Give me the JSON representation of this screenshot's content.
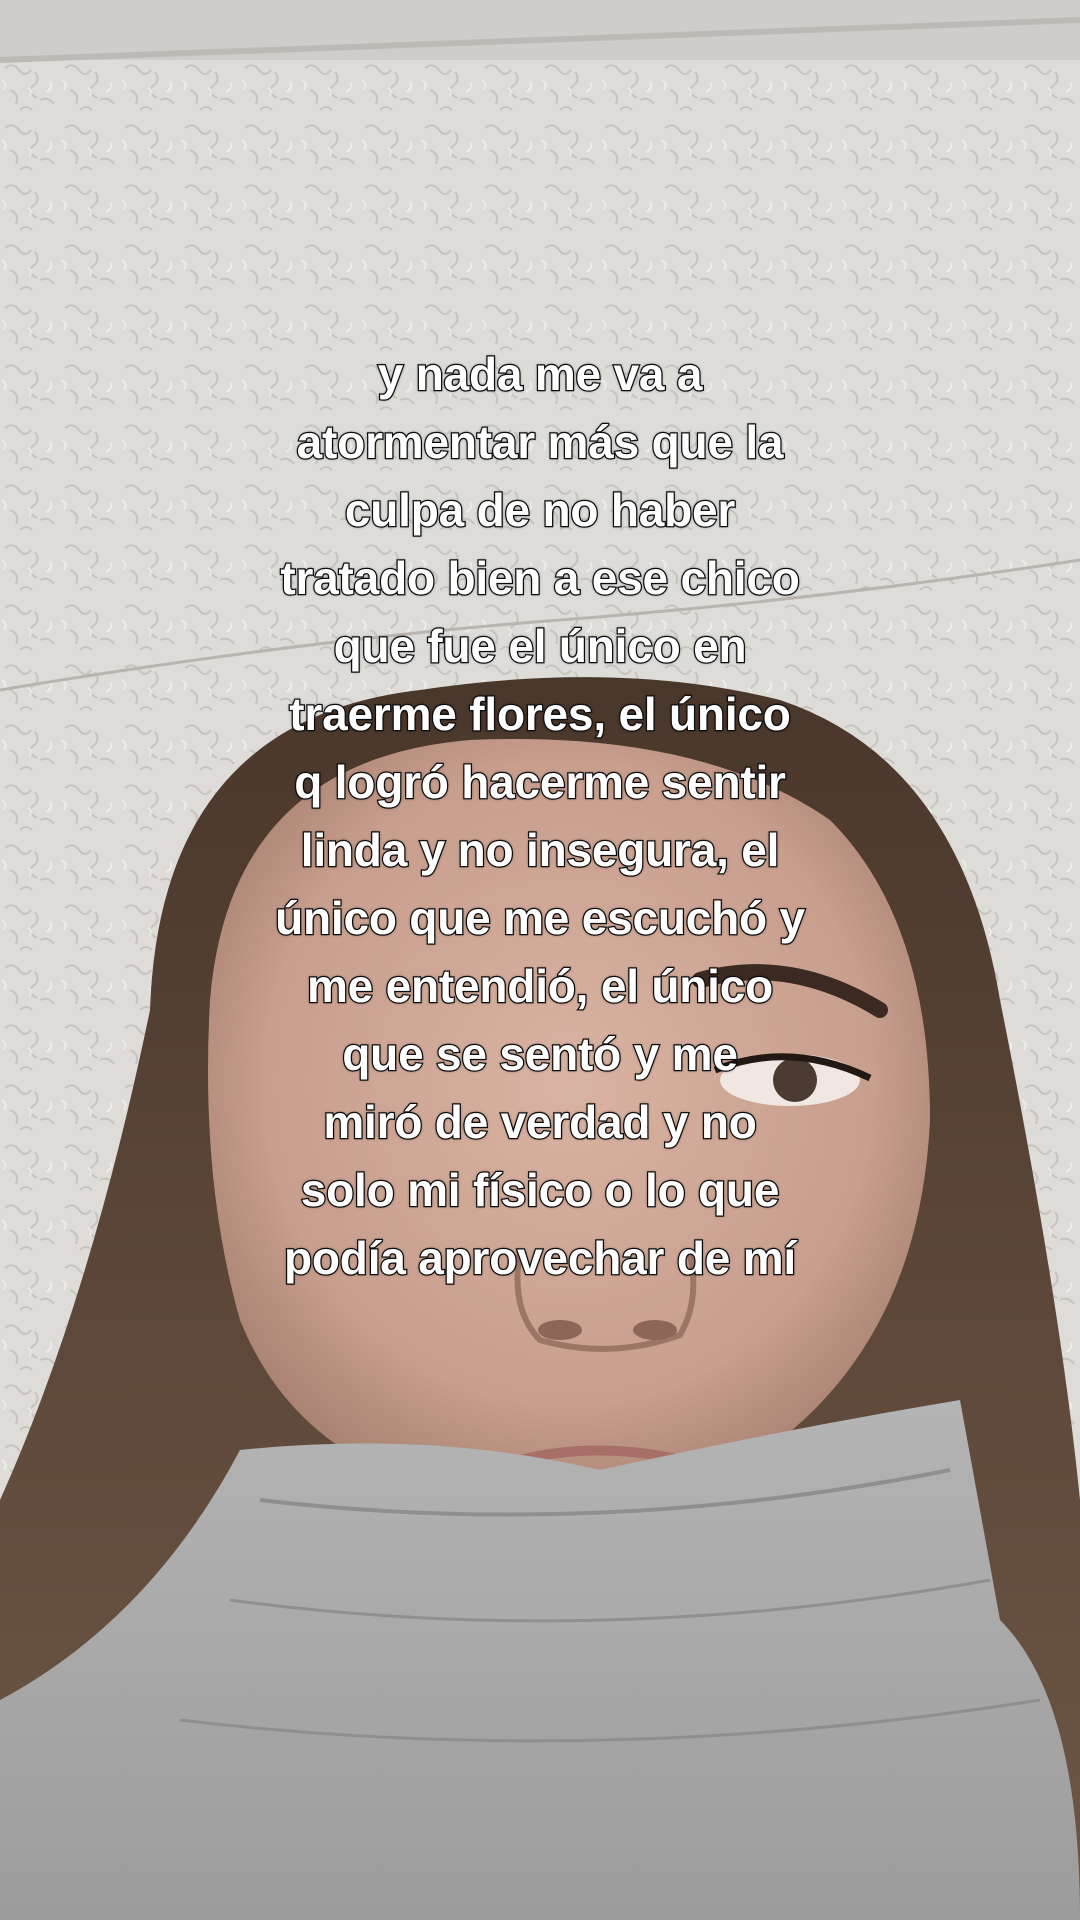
{
  "caption": {
    "lines": [
      "y nada me va a",
      "atormentar más que la",
      "culpa de no haber",
      "tratado bien a ese chico",
      "que fue el único en",
      "traerme flores, el único",
      "q logró hacerme sentir",
      "linda y no insegura, el",
      "único que me escuchó y",
      "me entendió, el único",
      "que se sentó y me",
      "miró de verdad y no",
      "solo mi físico o lo que",
      "podía aprovechar de mí"
    ]
  },
  "colors": {
    "caption_text": "#ffffff",
    "caption_outline": "#111111",
    "wall": "#d9d7d3",
    "sweater": "#a9a9a9",
    "hair": "#3b2a20",
    "skin": "#c9a08e"
  }
}
